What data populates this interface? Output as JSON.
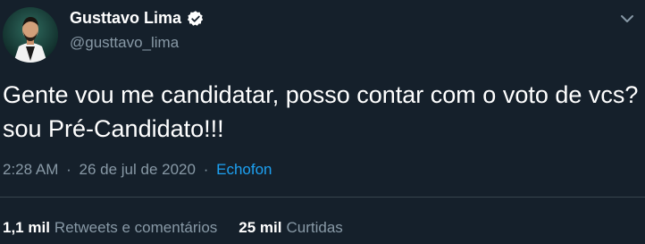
{
  "colors": {
    "background": "#15202b",
    "text_primary": "#ffffff",
    "text_secondary": "#8899a6",
    "accent": "#1da1f2",
    "divider": "#38444d"
  },
  "author": {
    "display_name": "Gusttavo Lima",
    "handle": "@gusttavo_lima",
    "verified": true,
    "avatar_icon": "profile-photo"
  },
  "tweet": {
    "text": "Gente vou me candidatar, posso contar com o voto de vcs? sou Pré-Candidato!!!",
    "time": "2:28 AM",
    "date": "26 de jul de 2020",
    "separator": "·",
    "source": "Echofon"
  },
  "stats": {
    "retweets_count": "1,1 mil",
    "retweets_label": "Retweets e comentários",
    "likes_count": "25 mil",
    "likes_label": "Curtidas"
  },
  "menu_icon": "chevron-down-icon"
}
